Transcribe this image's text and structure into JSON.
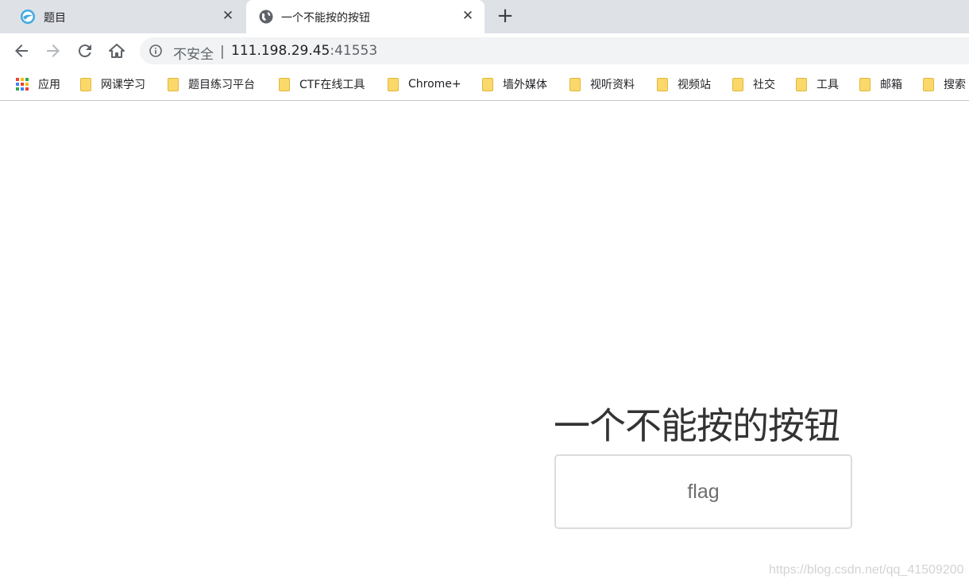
{
  "tabs": [
    {
      "title": "题目",
      "favicon": "swirl-logo-icon",
      "close": "✕"
    },
    {
      "title": "一个不能按的按钮",
      "favicon": "globe-icon",
      "close": "✕"
    }
  ],
  "new_tab": "+",
  "toolbar": {
    "back": "back-arrow-icon",
    "forward": "forward-arrow-icon",
    "reload": "reload-icon",
    "home": "home-icon"
  },
  "omnibox": {
    "security_label": "不安全",
    "divider": "|",
    "host": "111.198.29.45",
    "port": ":41553"
  },
  "bookmarks": [
    {
      "label": "应用",
      "icon": "apps-grid-icon"
    },
    {
      "label": "网课学习",
      "icon": "folder-icon"
    },
    {
      "label": "题目练习平台",
      "icon": "folder-icon"
    },
    {
      "label": "CTF在线工具",
      "icon": "folder-icon"
    },
    {
      "label": "Chrome+",
      "icon": "folder-icon"
    },
    {
      "label": "墙外媒体",
      "icon": "folder-icon"
    },
    {
      "label": "视听资料",
      "icon": "folder-icon"
    },
    {
      "label": "视频站",
      "icon": "folder-icon"
    },
    {
      "label": "社交",
      "icon": "folder-icon"
    },
    {
      "label": "工具",
      "icon": "folder-icon"
    },
    {
      "label": "邮箱",
      "icon": "folder-icon"
    },
    {
      "label": "搜索",
      "icon": "folder-icon"
    }
  ],
  "page": {
    "heading": "一个不能按的按钮",
    "button_label": "flag"
  },
  "watermark": "https://blog.csdn.net/qq_41509200",
  "colors": {
    "tabstrip": "#dee1e6",
    "omnibox": "#f1f3f4",
    "folder": "#fbd86a"
  }
}
